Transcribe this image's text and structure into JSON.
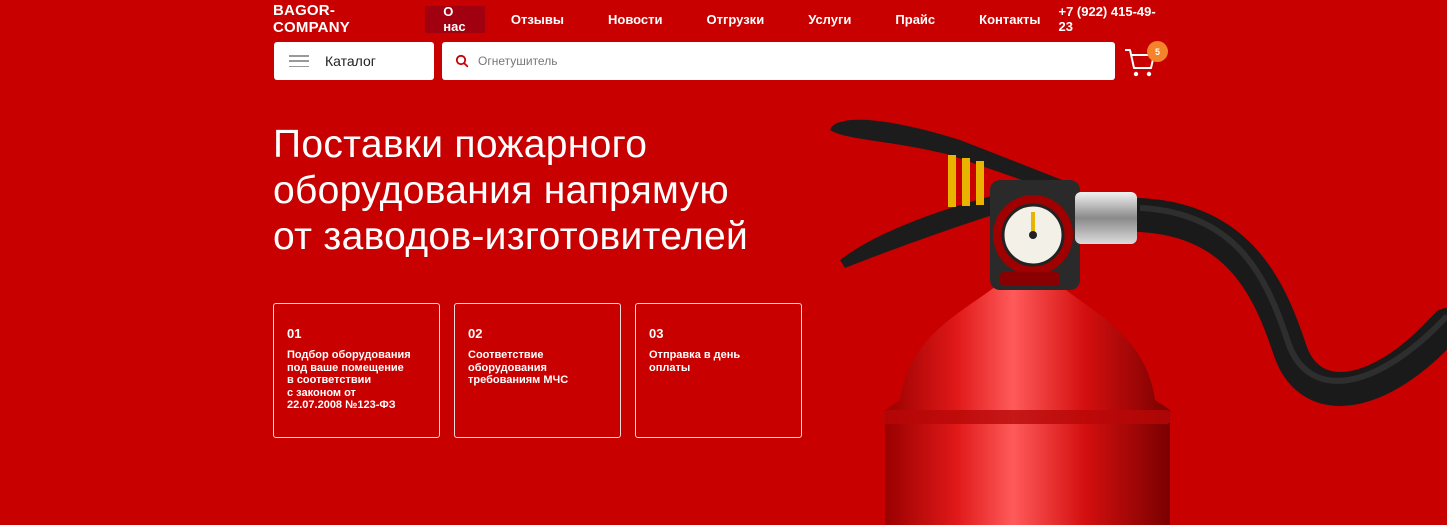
{
  "header": {
    "logo": "BAGOR-COMPANY",
    "nav": [
      "О нас",
      "Отзывы",
      "Новости",
      "Отгрузки",
      "Услуги",
      "Прайс",
      "Контакты"
    ],
    "active_nav": "О нас",
    "phone": "+7 (922) 415-49-23"
  },
  "catalog": {
    "label": "Каталог",
    "icon": "menu-icon"
  },
  "search": {
    "placeholder": "Огнетушитель",
    "icon": "search-icon"
  },
  "cart": {
    "count": "5",
    "icon": "cart-icon"
  },
  "hero": {
    "title_lines": [
      "Поставки пожарного",
      "оборудования напрямую",
      "от заводов-изготовителей"
    ]
  },
  "features": [
    {
      "num": "01",
      "text": "Подбор оборудования\nпод ваше помещение\nв соответствии\nс законом от\n22.07.2008 №123-ФЗ"
    },
    {
      "num": "02",
      "text": "Соответствие\nоборудования\nтребованиям МЧС"
    },
    {
      "num": "03",
      "text": "Отправка в день\nоплаты"
    }
  ],
  "colors": {
    "background": "#c80000",
    "active_nav": "#a0000f",
    "badge": "#f5832a"
  }
}
